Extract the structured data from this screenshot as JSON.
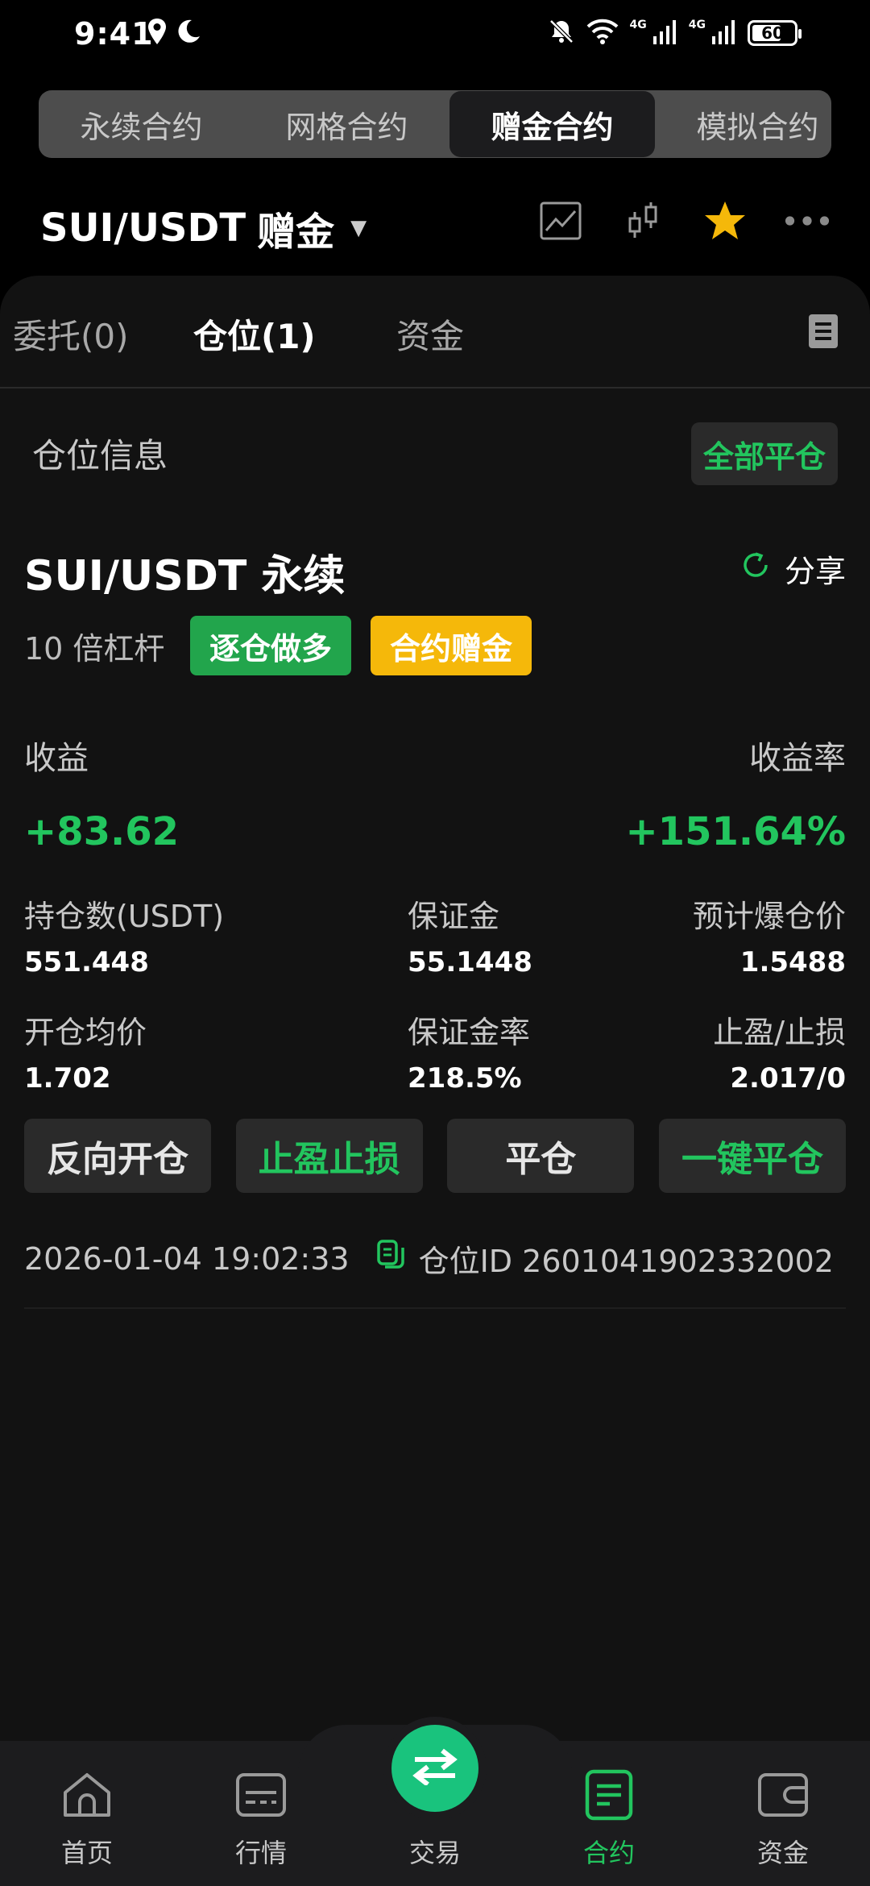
{
  "status_bar": {
    "time": "9:41",
    "network_1": "4G",
    "network_2": "4G",
    "battery": "60"
  },
  "top_tabs": [
    "永续合约",
    "网格合约",
    "赠金合约",
    "模拟合约"
  ],
  "pair": {
    "symbol": "SUI/USDT",
    "tag": "赠金"
  },
  "sub_tabs": {
    "orders": "委托(0)",
    "positions": "仓位(1)",
    "funds": "资金"
  },
  "section": {
    "title": "仓位信息",
    "close_all": "全部平仓"
  },
  "position": {
    "name": "SUI/USDT 永续",
    "share": "分享",
    "leverage": "10 倍杠杆",
    "side_badge": "逐仓做多",
    "bonus_badge": "合约赠金",
    "pnl_label": "收益",
    "pnl_value": "+83.62",
    "roi_label": "收益率",
    "roi_value": "+151.64%",
    "fields": {
      "size_label": "持仓数(USDT)",
      "size_value": "551.448",
      "margin_label": "保证金",
      "margin_value": "55.1448",
      "liq_label": "预计爆仓价",
      "liq_value": "1.5488",
      "entry_label": "开仓均价",
      "entry_value": "1.702",
      "margin_ratio_label": "保证金率",
      "margin_ratio_value": "218.5%",
      "tpsl_label": "止盈/止损",
      "tpsl_value": "2.017/0"
    },
    "buttons": {
      "reverse": "反向开仓",
      "tpsl": "止盈止损",
      "close": "平仓",
      "quick_close": "一键平仓"
    },
    "timestamp": "2026-01-04 19:02:33",
    "position_id": "仓位ID 2601041902332002"
  },
  "bottom_nav": {
    "home": "首页",
    "market": "行情",
    "trade": "交易",
    "contract": "合约",
    "funds": "资金"
  },
  "colors": {
    "accent_green": "#22c55e",
    "bonus_yellow": "#f5b80a",
    "star": "#f5b80a"
  },
  "icons": [
    "location-icon",
    "moon-icon",
    "bell-off-icon",
    "wifi-icon",
    "signal-icon",
    "chart-icon",
    "candlestick-icon",
    "star-icon",
    "more-icon",
    "document-icon",
    "share-icon",
    "copy-icon",
    "home-icon",
    "market-icon",
    "swap-icon",
    "contract-icon",
    "wallet-icon"
  ]
}
